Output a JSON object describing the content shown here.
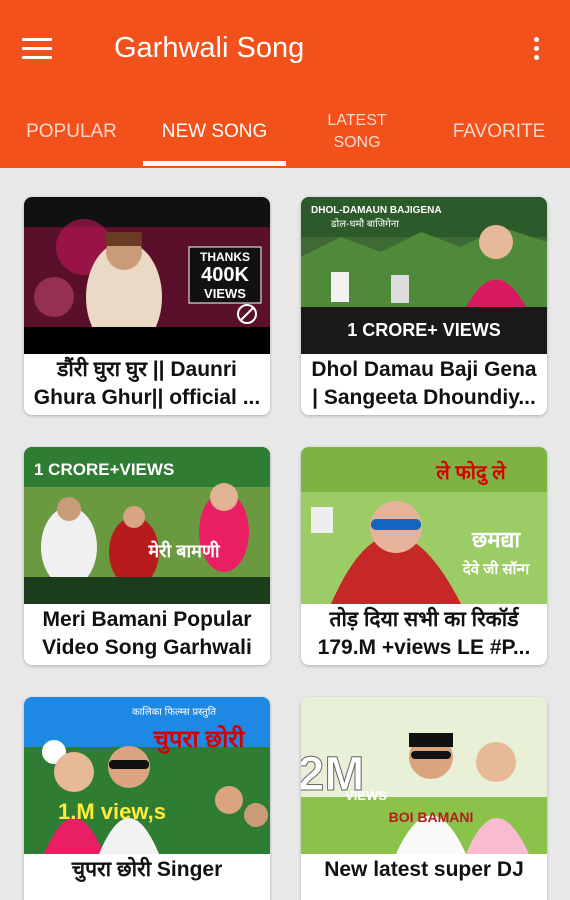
{
  "app": {
    "title": "Garhwali Song",
    "accent": "#f2511b"
  },
  "toolbar": {
    "menu_icon": "hamburger-menu-icon",
    "more_icon": "more-vert-icon"
  },
  "tabs": [
    {
      "label": "POPULAR",
      "active": false
    },
    {
      "label": "NEW SONG",
      "active": true
    },
    {
      "label": "LATEST\nSONG",
      "active": false
    },
    {
      "label": "FAVORITE",
      "active": false
    }
  ],
  "videos": [
    {
      "line1": "डौंरी घुरा घुर || Daunri",
      "line2": "Ghura Ghur|| official ...",
      "thumb": {
        "badge_top": "THANKS",
        "badge_mid": "400K",
        "badge_bot": "VIEWS"
      }
    },
    {
      "line1": "Dhol Damau Baji Gena",
      "line2": "| Sangeeta Dhoundiy...",
      "thumb": {
        "banner": "DHOL-DAMAUN BAJIGENA",
        "sub": "ढोल-धमौ बाजिगेना",
        "views": "1 CRORE+ VIEWS"
      }
    },
    {
      "line1": "Meri Bamani Popular",
      "line2": "Video Song Garhwali",
      "thumb": {
        "views": "1 CRORE+VIEWS",
        "name": "मेरी बामणी"
      }
    },
    {
      "line1": "तोड़ दिया सभी का रिकॉर्ड",
      "line2": "179.M +views LE #P...",
      "thumb": {
        "top": "ले फोदु ले",
        "name": "छमद्या",
        "sub": "देवे जी सॉन्ग"
      }
    },
    {
      "line1": "चुपरा छोरी Singer",
      "line2": "",
      "thumb": {
        "top": "कालिका फिल्म्स प्रस्तुति",
        "name": "चुपरा छोरी",
        "views": "1.M view,s"
      }
    },
    {
      "line1": "New latest super DJ",
      "line2": "",
      "thumb": {
        "views": "2M",
        "views_label": "VIEWS",
        "name": "BOI BAMANI"
      }
    }
  ]
}
